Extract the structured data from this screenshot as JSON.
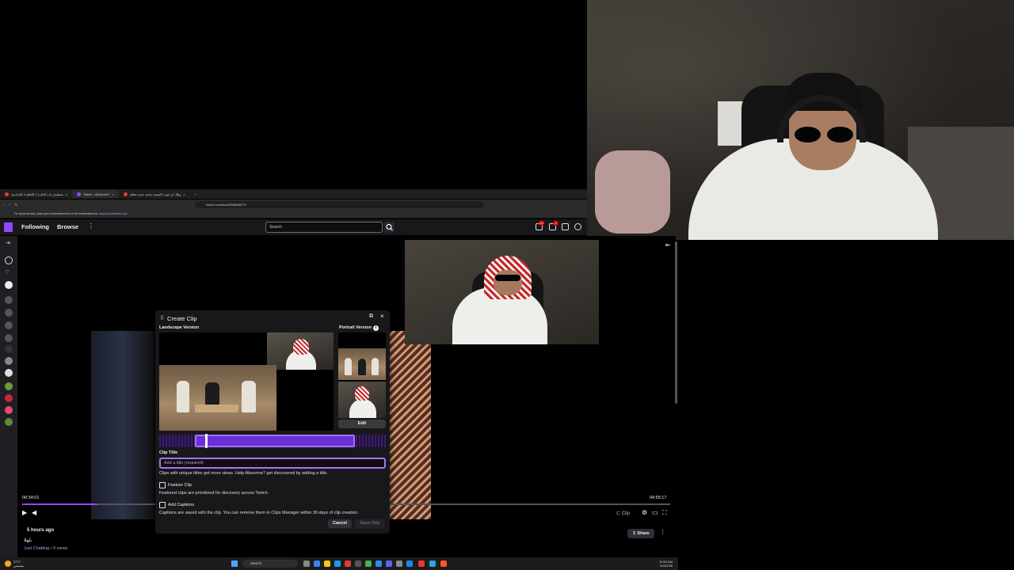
{
  "browser": {
    "tabs": [
      {
        "label": "مسلسل باب الحارة 2 الحلقة 4 السادسة",
        "active": false
      },
      {
        "label": "Twitch - Aboorme7",
        "active": true
      },
      {
        "label": "ويلك ان جوب البصمة محمد عبده عظام",
        "active": false
      }
    ],
    "new_tab": "+",
    "url": "twitch.tv/videos/2836668773",
    "bookmark_hint": "For quick access, place your bookmarks here on the bookmarks bar.",
    "bookmark_link": "Import bookmarks now..."
  },
  "topnav": {
    "following": "Following",
    "browse": "Browse",
    "more": "⋮",
    "search_placeholder": "Search",
    "badge_notifications": "13",
    "badge_inbox": "1"
  },
  "player": {
    "current_time": "00:34:01",
    "duration": "04:55:17",
    "progress_fraction": 0.116,
    "clip_label": "Clip"
  },
  "channel_info": {
    "time_ago": "5 hours ago",
    "title": "يلهلا",
    "category": "Just Chatting",
    "views": " • 0 views",
    "share": "Share",
    "more": "⋮"
  },
  "clip_dialog": {
    "title": "Create Clip",
    "landscape_label": "Landscape Version",
    "portrait_label": "Portrait Version",
    "edit": "Edit",
    "clip_title_label": "Clip Title",
    "title_placeholder": "Add a title (required)",
    "title_hint": "Clips with unique titles get more views. Help Aboorme7 get discovered by adding a title.",
    "feature_label": "Feature Clip",
    "feature_hint": "Featured clips are prioritized for discovery across Twitch.",
    "captions_label": "Add Captions",
    "captions_hint": "Captions are saved with the clip. You can remove them in Clips Manager within 30 days of clip creation.",
    "cancel": "Cancel",
    "save": "Save Clip"
  },
  "taskbar": {
    "weather_temp": "37°C",
    "weather_desc": "مشمس",
    "search": "Search",
    "time": "10:53 AM",
    "date": "6/4/2026"
  },
  "colors": {
    "twitch_purple": "#9147ff",
    "accent_light": "#a970ff",
    "badge_red": "#eb0400"
  }
}
